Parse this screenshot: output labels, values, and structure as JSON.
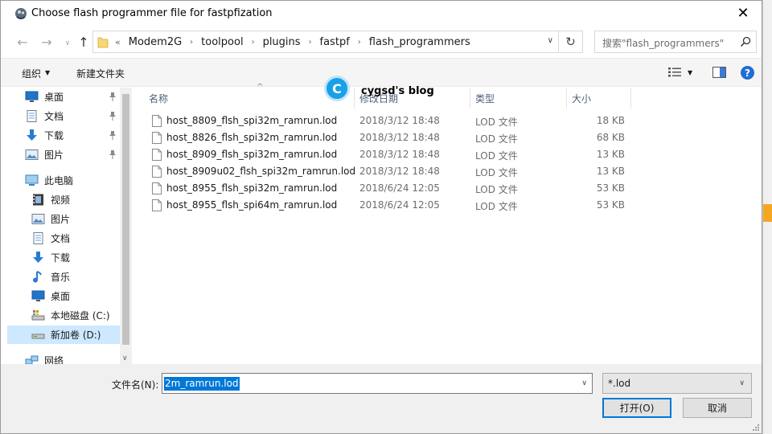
{
  "window": {
    "title": "Choose flash programmer file for fastpfization",
    "close_glyph": "✕"
  },
  "nav": {
    "back_glyph": "←",
    "forward_glyph": "→",
    "recent_glyph": "∨",
    "up_glyph": "↑",
    "crumb_prefix": "«",
    "breadcrumbs": [
      "Modem2G",
      "toolpool",
      "plugins",
      "fastpf",
      "flash_programmers"
    ],
    "crumb_separator": "›",
    "dropdown_glyph": "∨",
    "refresh_glyph": "↻",
    "search_placeholder": "搜索\"flash_programmers\""
  },
  "toolbar": {
    "organize": "组织",
    "organize_caret": "▼",
    "new_folder": "新建文件夹",
    "view_caret": "▼",
    "help": "?"
  },
  "sidebar": {
    "items": [
      {
        "label": "桌面",
        "icon": "desktop-icon",
        "pinned": true
      },
      {
        "label": "文档",
        "icon": "documents-icon",
        "pinned": true
      },
      {
        "label": "下载",
        "icon": "downloads-icon",
        "pinned": true
      },
      {
        "label": "图片",
        "icon": "pictures-icon",
        "pinned": true
      },
      {
        "label": "此电脑",
        "icon": "this-pc-icon",
        "pinned": false
      },
      {
        "label": "视频",
        "icon": "videos-icon",
        "pinned": false
      },
      {
        "label": "图片",
        "icon": "pictures-icon",
        "pinned": false
      },
      {
        "label": "文档",
        "icon": "documents-icon",
        "pinned": false
      },
      {
        "label": "下载",
        "icon": "downloads-icon",
        "pinned": false
      },
      {
        "label": "音乐",
        "icon": "music-icon",
        "pinned": false
      },
      {
        "label": "桌面",
        "icon": "desktop-icon",
        "pinned": false
      },
      {
        "label": "本地磁盘 (C:)",
        "icon": "local-disk-icon",
        "pinned": false
      },
      {
        "label": "新加卷 (D:)",
        "icon": "drive-icon",
        "pinned": false,
        "selected": true
      },
      {
        "label": "网络",
        "icon": "network-icon",
        "pinned": false
      }
    ],
    "scroll_down_glyph": "∨"
  },
  "filelist": {
    "columns": {
      "name": "名称",
      "date": "修改日期",
      "type": "类型",
      "size": "大小"
    },
    "sort_glyph": "^",
    "files": [
      {
        "name": "host_8809_flsh_spi32m_ramrun.lod",
        "date": "2018/3/12 18:48",
        "type": "LOD 文件",
        "size": "18 KB"
      },
      {
        "name": "host_8826_flsh_spi32m_ramrun.lod",
        "date": "2018/3/12 18:48",
        "type": "LOD 文件",
        "size": "68 KB"
      },
      {
        "name": "host_8909_flsh_spi32m_ramrun.lod",
        "date": "2018/3/12 18:48",
        "type": "LOD 文件",
        "size": "13 KB"
      },
      {
        "name": "host_8909u02_flsh_spi32m_ramrun.lod",
        "date": "2018/3/12 18:48",
        "type": "LOD 文件",
        "size": "13 KB"
      },
      {
        "name": "host_8955_flsh_spi32m_ramrun.lod",
        "date": "2018/6/24 12:05",
        "type": "LOD 文件",
        "size": "53 KB"
      },
      {
        "name": "host_8955_flsh_spi64m_ramrun.lod",
        "date": "2018/6/24 12:05",
        "type": "LOD 文件",
        "size": "53 KB"
      }
    ]
  },
  "watermark": {
    "logo_letter": "C",
    "text": "cygsd's blog"
  },
  "bottom": {
    "filename_label": "文件名(N):",
    "filename_value": "2m_ramrun.lod",
    "filename_caret": "∨",
    "filetype_value": "*.lod",
    "filetype_caret": "∨",
    "open_button": "打开(O)",
    "cancel_button": "取消"
  },
  "colors": {
    "accent": "#0078d7",
    "selection": "#cde8ff",
    "folder": "#f8d775",
    "help": "#1f6ed4"
  }
}
